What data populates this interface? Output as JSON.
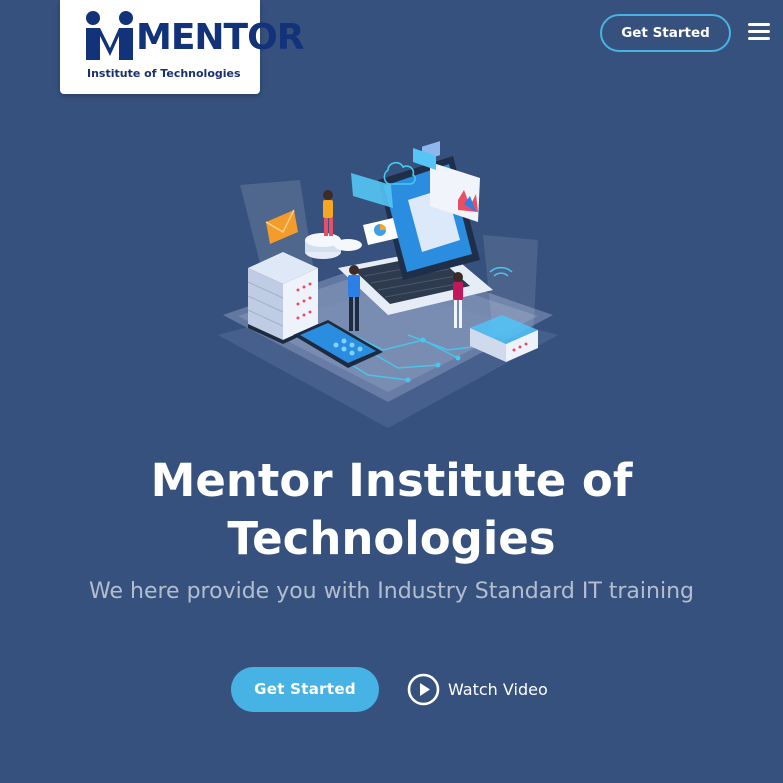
{
  "logo": {
    "wordmark": "MENTOR",
    "tagline": "Institute of Technologies"
  },
  "header": {
    "cta_label": "Get Started",
    "menu_icon": "hamburger-menu-icon"
  },
  "hero": {
    "title_line1": "Mentor Institute of",
    "title_line2": "Technologies",
    "subtitle": "We here provide you with Industry Standard IT training",
    "cta_label": "Get Started",
    "video_label": "Watch Video",
    "video_icon": "play-circle-icon"
  },
  "colors": {
    "background": "#37517e",
    "accent": "#47b2e4",
    "logo_navy": "#12327a"
  }
}
